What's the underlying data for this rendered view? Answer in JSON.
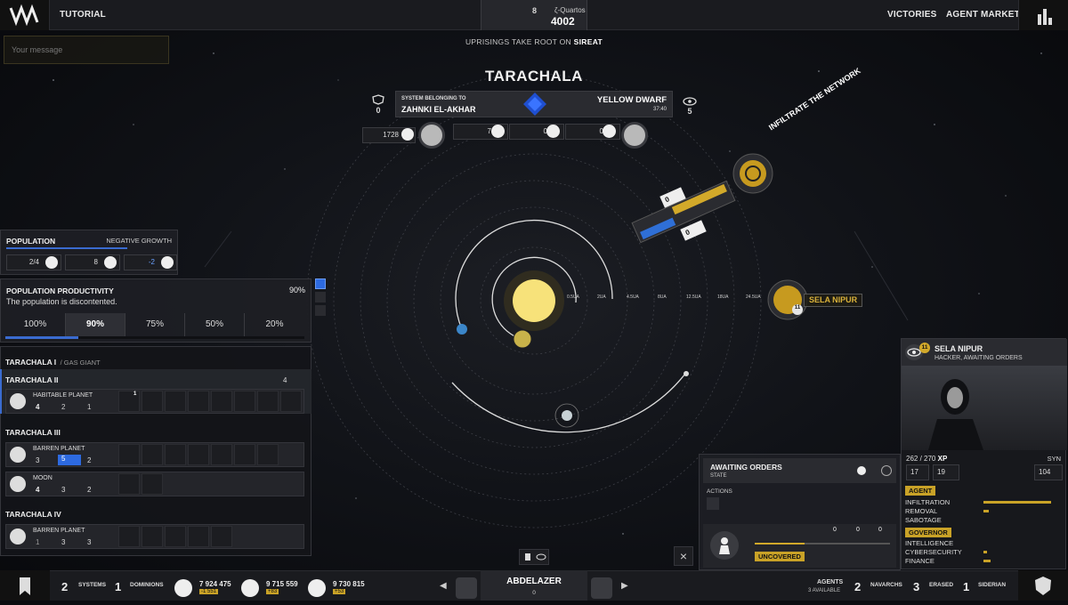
{
  "topbar": {
    "tutorial": "TUTORIAL",
    "res_count": "8",
    "res_name": "ζ-Quartos",
    "res_value": "4002",
    "victories": "VICTORIES",
    "agent_market": "AGENT MARKET"
  },
  "message_placeholder": "Your message",
  "uprising": {
    "prefix": "UPRISINGS TAKE ROOT ON ",
    "place": "SIREAT"
  },
  "system": {
    "name": "TARACHALA",
    "left_count": "0",
    "belong_label": "SYSTEM BELONGING TO",
    "owner": "ZAHNKI EL-AKHAR",
    "star_type": "YELLOW DWARF",
    "time": "37:40",
    "right_count": "5",
    "stat_a": "1728",
    "stat_b": "7",
    "stat_c": "0",
    "stat_d": "0"
  },
  "orbits": {
    "labels": [
      "0.5UA",
      "2UA",
      "4.5UA",
      "8UA",
      "12.5UA",
      "18UA",
      "24.5UA"
    ]
  },
  "network": {
    "label": "INFILTRATE THE NETWORK",
    "top_val": "0",
    "bottom_val": "0"
  },
  "agent_marker": {
    "name": "SELA NIPUR",
    "level": "11"
  },
  "population": {
    "label": "POPULATION",
    "growth": "NEGATIVE GROWTH",
    "v1": "2/4",
    "v2": "8",
    "v3": "-2"
  },
  "productivity": {
    "label": "POPULATION PRODUCTIVITY",
    "value": "90%",
    "status": "The population is discontented.",
    "tabs": [
      "100%",
      "90%",
      "75%",
      "50%",
      "20%"
    ],
    "selected": "90%"
  },
  "planets": {
    "t1": {
      "name": "TARACHALA I",
      "type": "/ GAS GIANT"
    },
    "t2": {
      "name": "TARACHALA II",
      "count": "4",
      "body": "HABITABLE PLANET",
      "a": "4",
      "b": "2",
      "c": "1",
      "slot_badge": "1"
    },
    "t3": {
      "name": "TARACHALA III",
      "body1": "BARREN PLANET",
      "b1a": "3",
      "b1b": "5",
      "b1c": "2",
      "body2": "MOON",
      "b2a": "4",
      "b2b": "3",
      "b2c": "2"
    },
    "t4": {
      "name": "TARACHALA IV",
      "body": "BARREN PLANET",
      "a": "1",
      "b": "3",
      "c": "3"
    }
  },
  "orders": {
    "title": "AWAITING ORDERS",
    "state": "STATE",
    "actions": "ACTIONS",
    "r1": "0",
    "r2": "0",
    "r3": "0",
    "uncovered": "UNCOVERED"
  },
  "agent": {
    "level": "11",
    "name": "SELA NIPUR",
    "role": "HACKER, AWAITING ORDERS",
    "xp": "262 / 270",
    "xp_label": "XP",
    "syn": "SYN",
    "s1": "17",
    "s2": "19",
    "s3": "104",
    "tag_agent": "AGENT",
    "infiltration": "INFILTRATION",
    "removal": "REMOVAL",
    "sabotage": "SABOTAGE",
    "tag_governor": "GOVERNOR",
    "intelligence": "INTELLIGENCE",
    "cybersecurity": "CYBERSECURITY",
    "finance": "FINANCE"
  },
  "bottombar": {
    "systems_n": "2",
    "systems": "SYSTEMS",
    "dominions_n": "1",
    "dominions": "DOMINIONS",
    "r1": "7 924 475",
    "r1d": "-1 551",
    "r2": "9 715 559",
    "r2d": "+83",
    "r3": "9 730 815",
    "r3d": "+53",
    "player": "ABDELAZER",
    "player_n": "0",
    "agents": "AGENTS",
    "agents_avail": "3 AVAILABLE",
    "navarchs_n": "2",
    "navarchs": "NAVARCHS",
    "erased_n": "3",
    "erased": "ERASED",
    "siderian_n": "1",
    "siderian": "SIDERIAN"
  }
}
